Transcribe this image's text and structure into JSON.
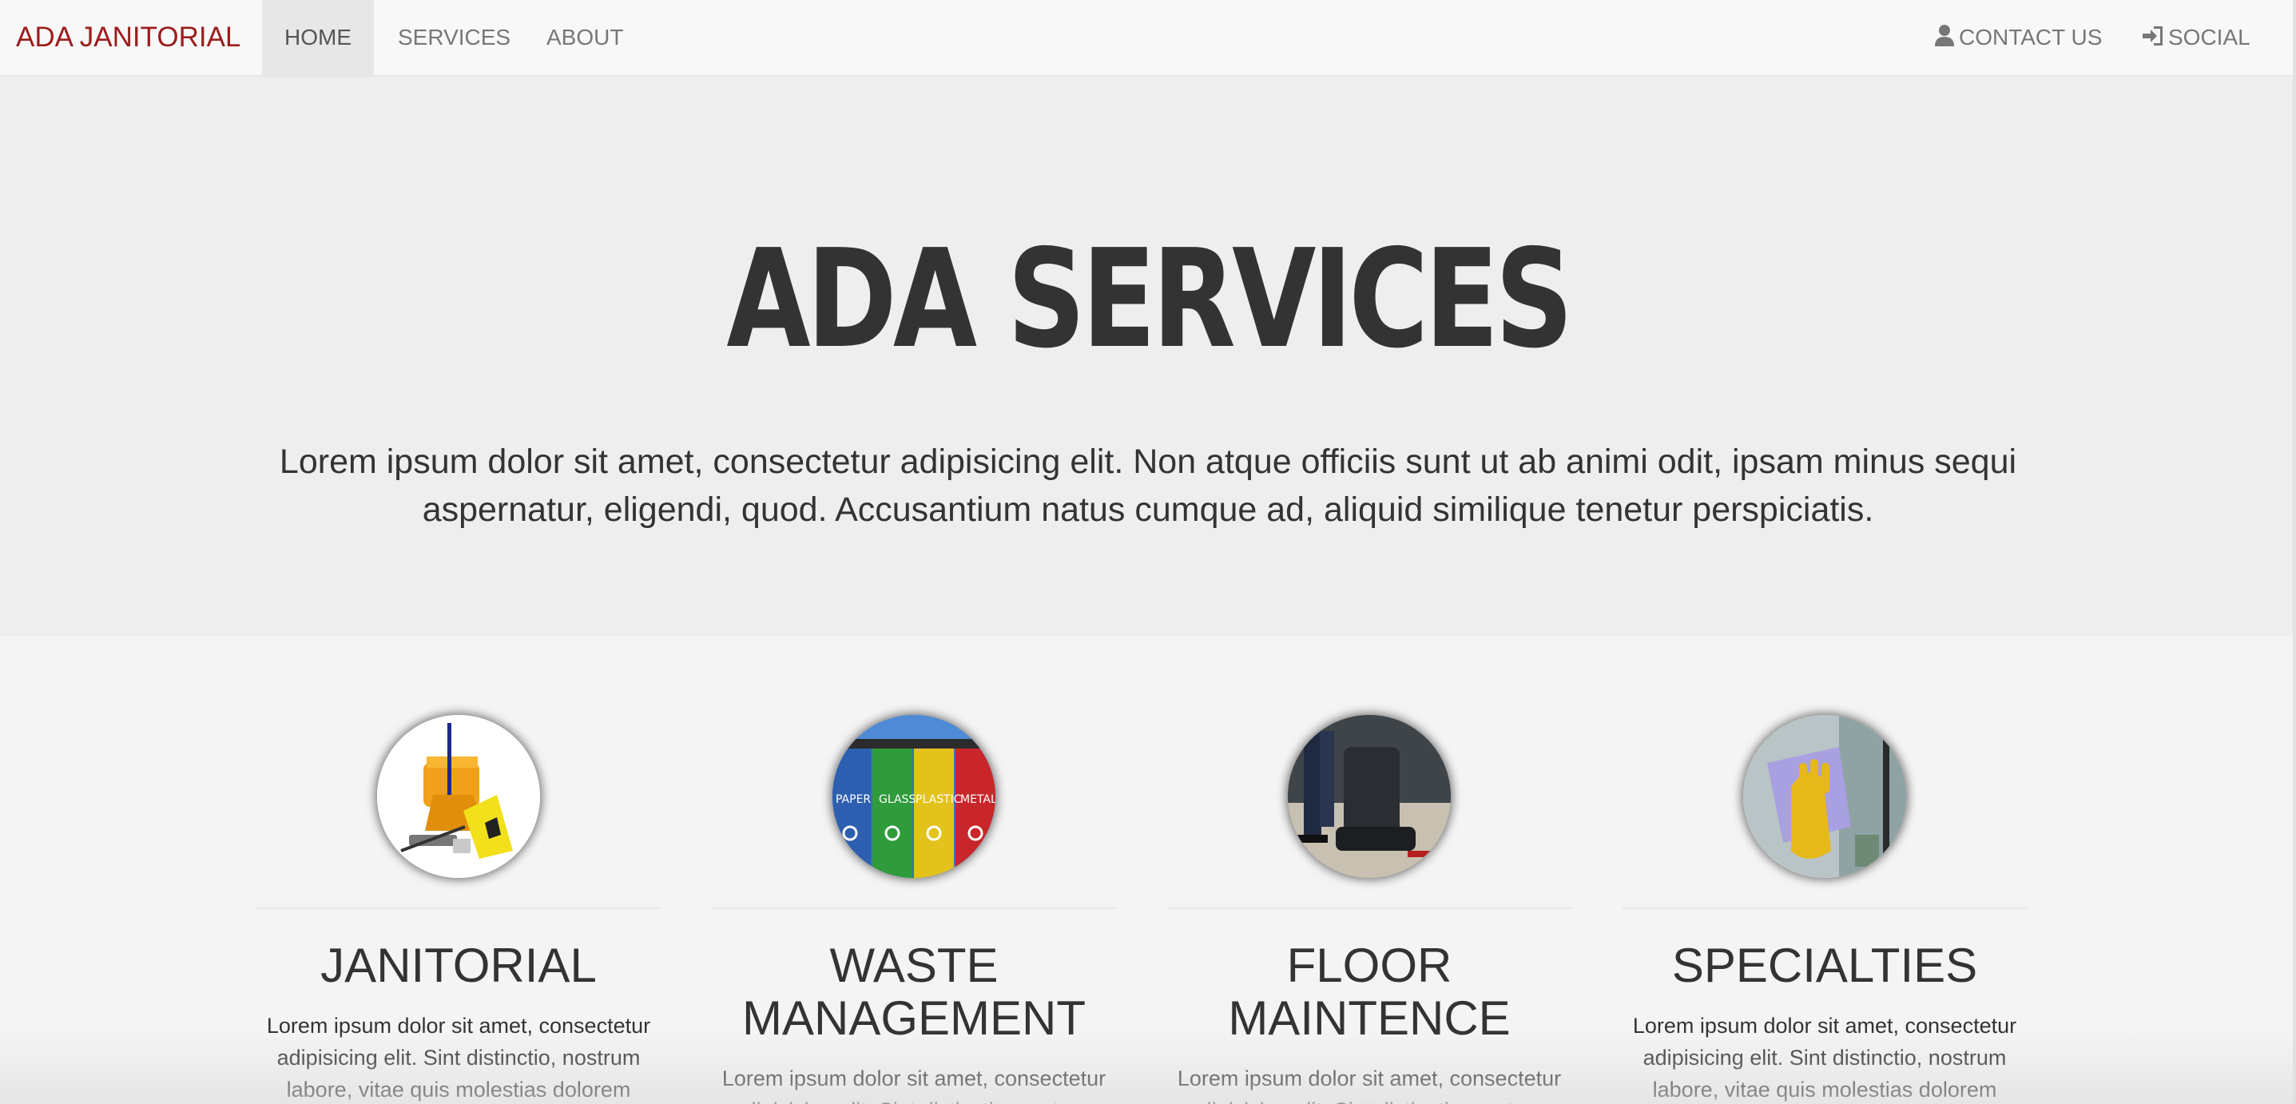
{
  "navbar": {
    "brand": "ADA JANITORIAL",
    "links": [
      {
        "label": "HOME"
      },
      {
        "label": "SERVICES"
      },
      {
        "label": "ABOUT"
      }
    ],
    "right_links": [
      {
        "label": "CONTACT US",
        "icon": "user-icon"
      },
      {
        "label": "SOCIAL",
        "icon": "sign-in-icon"
      }
    ]
  },
  "hero": {
    "title": "ADA SERVICES",
    "text": "Lorem ipsum dolor sit amet, consectetur adipisicing elit. Non atque officiis sunt ut ab animi odit, ipsam minus sequi aspernatur, eligendi, quod. Accusantium natus cumque ad, aliquid similique tenetur perspiciatis."
  },
  "services": [
    {
      "title": "JANITORIAL",
      "image": "janitorial-supplies-image",
      "text": "Lorem ipsum dolor sit amet, consectetur adipisicing elit. Sint distinctio, nostrum labore, vitae quis molestias dolorem"
    },
    {
      "title": "WASTE MANAGEMENT",
      "image": "recycling-bins-image",
      "text": "Lorem ipsum dolor sit amet, consectetur adipisicing elit. Sint distinctio, nostrum"
    },
    {
      "title": "FLOOR MAINTENCE",
      "image": "floor-scrubber-image",
      "text": "Lorem ipsum dolor sit amet, consectetur adipisicing elit. Sint distinctio, nostrum"
    },
    {
      "title": "SPECIALTIES",
      "image": "window-cleaning-image",
      "text": "Lorem ipsum dolor sit amet, consectetur adipisicing elit. Sint distinctio, nostrum labore, vitae quis molestias dolorem"
    }
  ],
  "bin_labels": [
    "PAPER",
    "GLASS",
    "PLASTIC",
    "METAL"
  ],
  "colors": {
    "brand": "#9d1d1d",
    "text": "#333333",
    "hero_bg": "#eeeeee",
    "page_bg": "#f4f4f4"
  }
}
